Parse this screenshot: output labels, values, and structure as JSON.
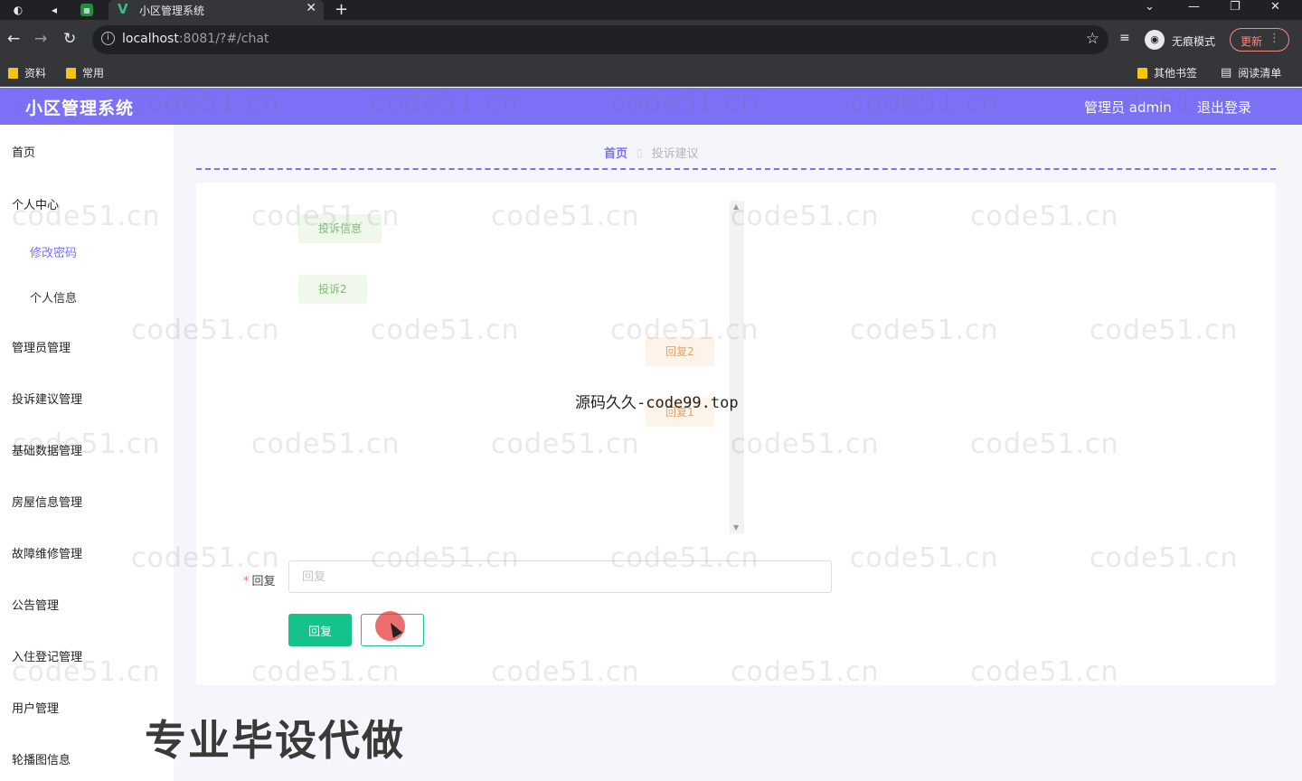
{
  "browser": {
    "tab_title": "小区管理系统",
    "url_host": "localhost",
    "url_path": ":8081/?#/chat",
    "incognito_label": "无痕模式",
    "update_label": "更新",
    "bookmarks_left": [
      "资料",
      "常用"
    ],
    "bookmarks_right": [
      "其他书签",
      "阅读清单"
    ]
  },
  "header": {
    "title": "小区管理系统",
    "admin_label": "管理员 admin",
    "logout_label": "退出登录",
    "color": "#7b70f6"
  },
  "sidebar": {
    "home": "首页",
    "personal_center": "个人中心",
    "change_password": "修改密码",
    "personal_info": "个人信息",
    "items": [
      "管理员管理",
      "投诉建议管理",
      "基础数据管理",
      "房屋信息管理",
      "故障维修管理",
      "公告管理",
      "入住登记管理",
      "用户管理",
      "轮播图信息"
    ]
  },
  "breadcrumb": {
    "home": "首页",
    "current": "投诉建议"
  },
  "chat": {
    "left_messages": [
      "投诉信息",
      "投诉2"
    ],
    "right_messages": [
      "回复2",
      "回复1"
    ]
  },
  "form": {
    "reply_label": "回复",
    "reply_placeholder": "回复",
    "reply_value": "",
    "submit_label": "回复",
    "second_label": ""
  },
  "overlays": {
    "watermark": "code51.cn",
    "center_text": "源码久久-code99.top",
    "promo": "专业毕设代做"
  },
  "colors": {
    "accent": "#7b70f6",
    "button": "#15c28c"
  }
}
